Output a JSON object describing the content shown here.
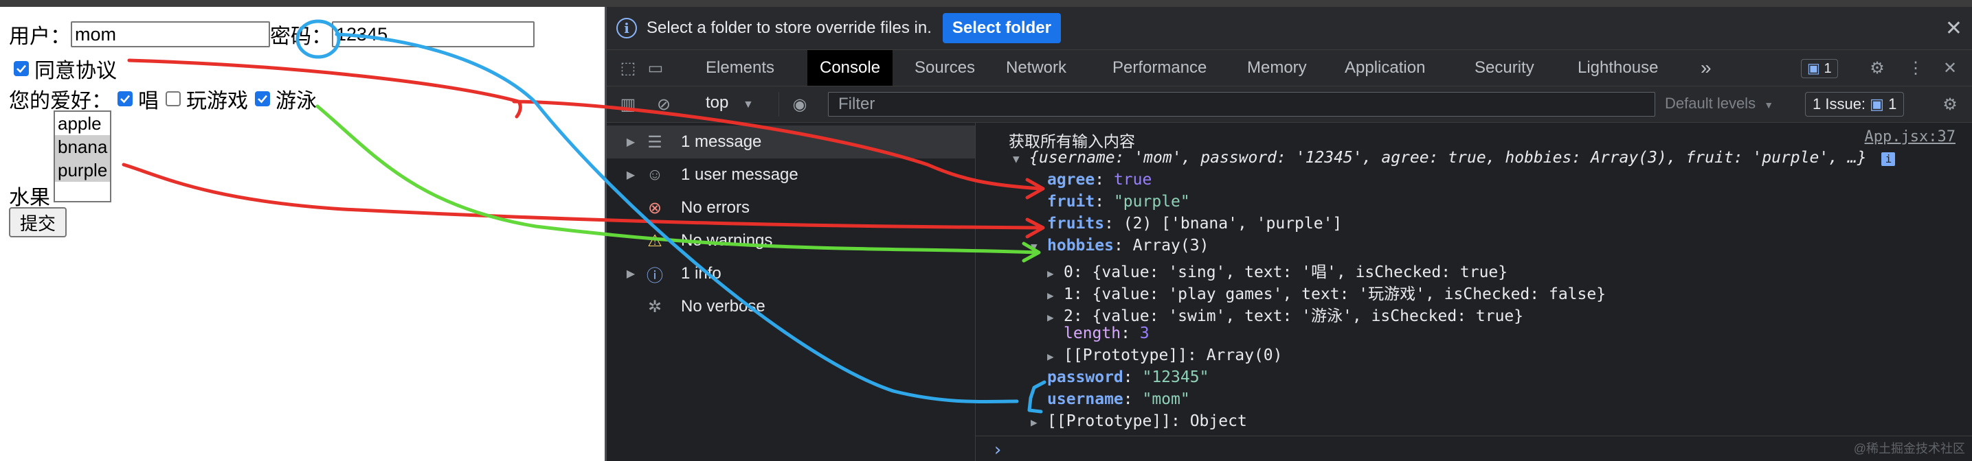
{
  "form": {
    "user_label": "用户：",
    "user_value": "mom",
    "password_label": "密码：",
    "password_value": "12345",
    "agree_label": "同意协议",
    "hobbies_label": "您的爱好：",
    "hobbies": [
      "唱",
      "玩游戏",
      "游泳"
    ],
    "fruit_label": "水果",
    "fruit_options": [
      "apple",
      "bnana",
      "purple"
    ],
    "submit_label": "提交"
  },
  "devtools": {
    "info_text": "Select a folder to store override files in.",
    "select_folder_label": "Select folder",
    "tabs": [
      "Elements",
      "Console",
      "Sources",
      "Network",
      "Performance",
      "Memory",
      "Application",
      "Security",
      "Lighthouse"
    ],
    "more_tabs": "»",
    "message_count": "1",
    "context": "top",
    "filter_placeholder": "Filter",
    "levels": "Default levels",
    "issues": "1 Issue:",
    "issues_count": "1",
    "sidebar": [
      "1 message",
      "1 user message",
      "No errors",
      "No warnings",
      "1 info",
      "No verbose"
    ],
    "console": {
      "log_title": "获取所有输入内容",
      "source": "App.jsx:37",
      "summary": "{username: 'mom', password: '12345', agree: true, hobbies: Array(3), fruit: 'purple', …}",
      "agree_key": "agree",
      "agree_val": "true",
      "fruit_key": "fruit",
      "fruit_val": "\"purple\"",
      "fruits_key": "fruits",
      "fruits_val": "(2) ['bnana', 'purple']",
      "hobbies_key": "hobbies",
      "hobbies_val": "Array(3)",
      "hobby0": "0: {value: 'sing', text: '唱', isChecked: true}",
      "hobby1": "1: {value: 'play games', text: '玩游戏', isChecked: false}",
      "hobby2": "2: {value: 'swim', text: '游泳', isChecked: true}",
      "length_key": "length",
      "length_val": "3",
      "proto_arr": "[[Prototype]]: Array(0)",
      "password_key": "password",
      "password_val": "\"12345\"",
      "username_key": "username",
      "username_val": "\"mom\"",
      "proto_obj": "[[Prototype]]: Object",
      "prompt": "›"
    },
    "watermark": "@稀土掘金技术社区"
  },
  "colors": {
    "annotation_red": "#e8302a",
    "annotation_green": "#62d83b",
    "annotation_blue": "#2fa7e8",
    "accent_blue": "#1a73e8"
  }
}
